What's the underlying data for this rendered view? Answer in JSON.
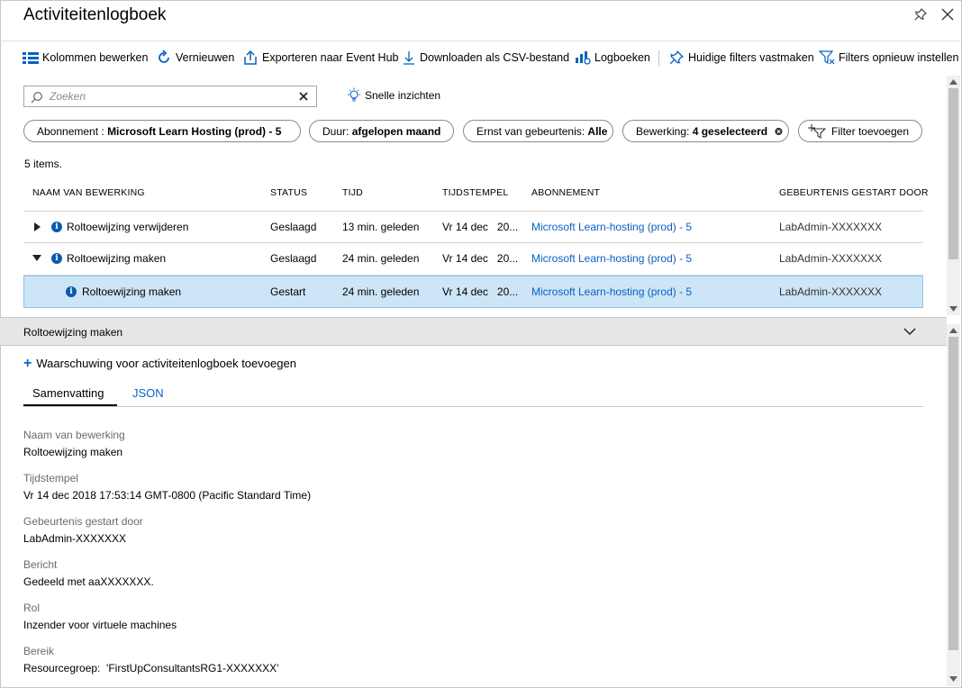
{
  "header": {
    "title": "Activiteitenlogboek",
    "pin_icon": "pin-icon",
    "close_icon": "close-icon"
  },
  "toolbar": {
    "items": [
      {
        "label": "Kolommen bewerken",
        "icon": "columns-icon"
      },
      {
        "label": "Vernieuwen",
        "icon": "refresh-icon"
      },
      {
        "label": "Exporteren naar Event Hub",
        "icon": "export-icon"
      },
      {
        "label": "Downloaden als CSV-bestand",
        "icon": "download-icon"
      },
      {
        "label": "Logboeken",
        "icon": "logs-icon"
      },
      {
        "label": "Huidige filters vastmaken",
        "icon": "pin-icon"
      },
      {
        "label": "Filters opnieuw instellen",
        "icon": "filter-reset-icon"
      }
    ]
  },
  "search": {
    "placeholder": "Zoeken",
    "value": ""
  },
  "quick_insights": "Snelle inzichten",
  "filters": [
    {
      "prefix": "Abonnement : ",
      "value": "Microsoft Learn Hosting (prod) - 5"
    },
    {
      "prefix": "Duur: ",
      "value": "afgelopen maand"
    },
    {
      "prefix": "Ernst van gebeurtenis: ",
      "value": "Alle"
    },
    {
      "prefix": "Bewerking: ",
      "value": "4 geselecteerd"
    }
  ],
  "add_filter": "Filter toevoegen",
  "item_count": "5 items.",
  "table": {
    "columns": [
      "NAAM VAN BEWERKING",
      "STATUS",
      "TIJD",
      "TIJDSTEMPEL",
      "ABONNEMENT",
      "GEBEURTENIS GESTART DOOR"
    ],
    "rows": [
      {
        "name": "Roltoewijzing verwijderen",
        "status": "Geslaagd",
        "time": "13 min. geleden",
        "timestamp": "Vr 14 dec   20...",
        "subscription": "Microsoft Learn-hosting (prod) - 5",
        "initiated_by": "LabAdmin-XXXXXXX",
        "expander": "collapsed"
      },
      {
        "name": "Roltoewijzing maken",
        "status": "Geslaagd",
        "time": "24 min. geleden",
        "timestamp": "Vr 14 dec   20...",
        "subscription": "Microsoft Learn-hosting (prod) - 5",
        "initiated_by": "LabAdmin-XXXXXXX",
        "expander": "expanded"
      },
      {
        "name": "Roltoewijzing maken",
        "status": "Gestart",
        "time": "24 min. geleden",
        "timestamp": "Vr 14 dec   20...",
        "subscription": "Microsoft Learn-hosting (prod) - 5",
        "initiated_by": "LabAdmin-XXXXXXX",
        "expander": "none"
      }
    ]
  },
  "detail": {
    "title": "Roltoewijzing maken",
    "add_alert": "Waarschuwing voor activiteitenlogboek toevoegen",
    "tabs": [
      "Samenvatting",
      "JSON"
    ],
    "fields": [
      {
        "label": "Naam van bewerking",
        "value": "Roltoewijzing maken"
      },
      {
        "label": "Tijdstempel",
        "value": "Vr 14 dec 2018 17:53:14 GMT-0800 (Pacific Standard Time)"
      },
      {
        "label": "Gebeurtenis gestart door",
        "value": "LabAdmin-XXXXXXX"
      },
      {
        "label": "Bericht",
        "value": "Gedeeld met aaXXXXXXX."
      },
      {
        "label": "Rol",
        "value": "Inzender voor virtuele machines"
      },
      {
        "label": "Bereik",
        "value": "Resourcegroep:  'FirstUpConsultantsRG1-XXXXXXX'"
      }
    ]
  },
  "colors": {
    "accent": "#0a60c2",
    "selected_row": "#cde6f7",
    "info_icon": "#0b5cad"
  }
}
